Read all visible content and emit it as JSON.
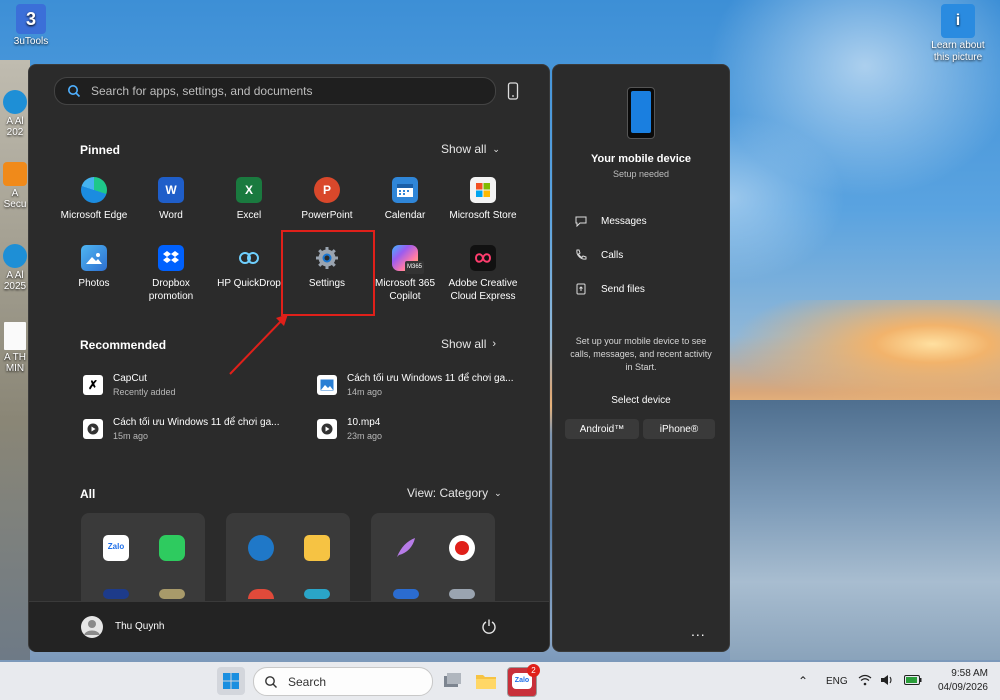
{
  "desktop": {
    "icons": [
      {
        "label": "3uTools"
      },
      {
        "label": "Learn about this picture"
      }
    ],
    "left_labels": [
      "A Al",
      "202",
      "A",
      "Secu",
      "A Al",
      "2025",
      "A TH",
      "MIN"
    ]
  },
  "start": {
    "search_placeholder": "Search for apps, settings, and documents",
    "pinned": {
      "title": "Pinned",
      "show_all": "Show all",
      "apps": [
        {
          "label": "Microsoft Edge"
        },
        {
          "label": "Word"
        },
        {
          "label": "Excel"
        },
        {
          "label": "PowerPoint"
        },
        {
          "label": "Calendar"
        },
        {
          "label": "Microsoft Store"
        },
        {
          "label": "Photos"
        },
        {
          "label": "Dropbox promotion"
        },
        {
          "label": "HP QuickDrop"
        },
        {
          "label": "Settings"
        },
        {
          "label": "Microsoft 365 Copilot"
        },
        {
          "label": "Adobe Creative Cloud Express"
        }
      ],
      "m365_badge": "M365"
    },
    "recommended": {
      "title": "Recommended",
      "show_all": "Show all",
      "items": [
        {
          "name": "CapCut",
          "sub": "Recently added"
        },
        {
          "name": "Cách tối ưu Windows 11 để chơi ga...",
          "sub": "14m ago"
        },
        {
          "name": "Cách tối ưu Windows 11 để chơi ga...",
          "sub": "15m ago"
        },
        {
          "name": "10.mp4",
          "sub": "23m ago"
        }
      ]
    },
    "all": {
      "title": "All",
      "view": "View: Category"
    },
    "user": {
      "name": "Thu Quynh"
    }
  },
  "phone_panel": {
    "title": "Your mobile device",
    "subtitle": "Setup needed",
    "items": [
      "Messages",
      "Calls",
      "Send files"
    ],
    "description": "Set up your mobile device to see calls, messages, and recent activity in Start.",
    "select_label": "Select device",
    "buttons": [
      "Android™",
      "iPhone®"
    ],
    "more": "..."
  },
  "taskbar": {
    "search": "Search",
    "zalo_badge": "2",
    "language": "ENG",
    "time": "9:58 AM",
    "date": "04/09/2026"
  },
  "colors": {
    "highlight": "#e0201a",
    "panel_bg": "#2b2b2b"
  }
}
